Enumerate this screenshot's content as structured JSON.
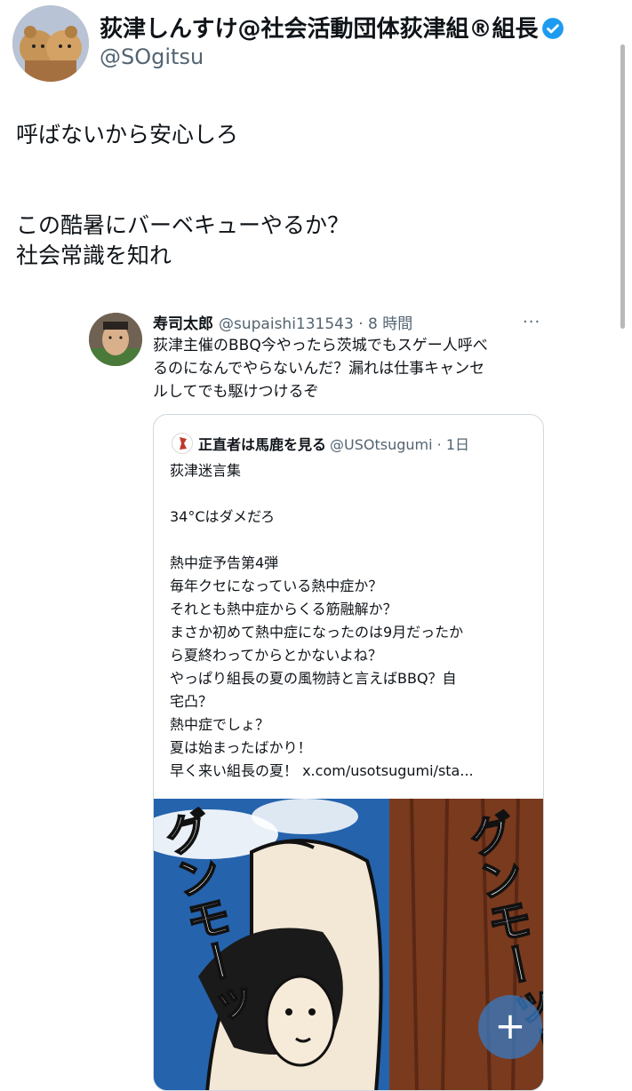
{
  "author": {
    "name": "荻津しんすけ@社会活動団体荻津組®組長",
    "handle": "@SOgitsu",
    "verified_color": "#1d9bf0"
  },
  "tweet": {
    "lines": [
      "呼ばないから安心しろ",
      "この酷暑にバーベキューやるか？",
      "社会常識を知れ"
    ]
  },
  "reply": {
    "name": "寿司太郎",
    "handle_time": "@supaishi131543 · 8 時間",
    "more_icon": "more-icon",
    "lines": [
      "荻津主催のBBQ今やったら茨城でもスゲー人呼べ",
      "るのになんでやらないんだ？漏れは仕事キャンセ",
      "ルしてでも駆けつけるぞ"
    ]
  },
  "quote": {
    "name": "正直者は馬鹿を見る",
    "handle_time": "@USOtsugumi · 1日",
    "paragraphs": [
      [
        "荻津迷言集"
      ],
      [
        "34°Cはダメだろ"
      ],
      [
        "熱中症予告第4弾",
        "毎年クセになっている熱中症か？",
        "それとも熱中症からくる筋融解か？",
        "まさか初めて熱中症になったのは9月だったか",
        "ら夏終わってからとかないよね？",
        "やっぱり組長の夏の風物詩と言えばBBQ？自",
        "宅凸？",
        "熱中症でしょ？",
        "夏は始まったばかり！",
        "早く来い組長の夏！ x.com/usotsugumi/sta..."
      ]
    ],
    "image_text_left": "グンモーッ",
    "image_text_right": "グンモーッ！"
  },
  "fab_label": "+"
}
